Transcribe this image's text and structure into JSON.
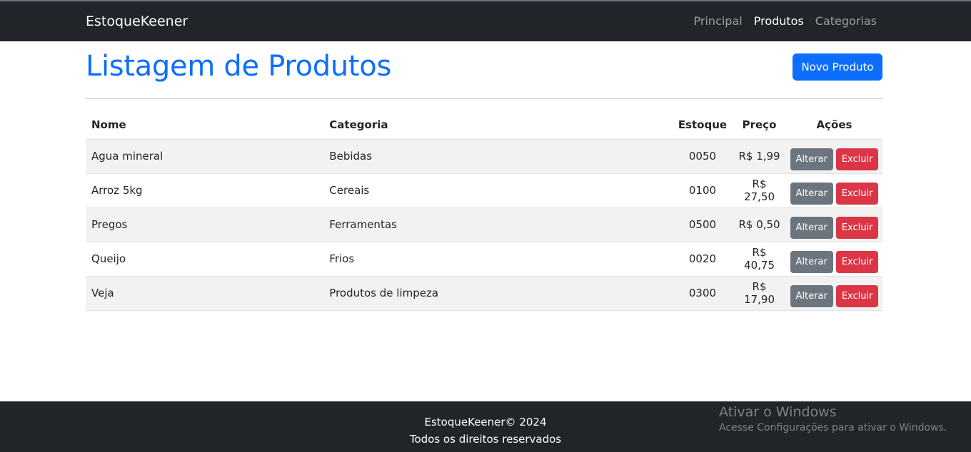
{
  "navbar": {
    "brand": "EstoqueKeener",
    "links": [
      {
        "label": "Principal",
        "active": false
      },
      {
        "label": "Produtos",
        "active": true
      },
      {
        "label": "Categorias",
        "active": false
      }
    ]
  },
  "page": {
    "title": "Listagem de Produtos",
    "new_button": "Novo Produto"
  },
  "table": {
    "headers": {
      "nome": "Nome",
      "categoria": "Categoria",
      "estoque": "Estoque",
      "preco": "Preço",
      "acoes": "Ações"
    },
    "rows": [
      {
        "nome": "Agua mineral",
        "categoria": "Bebidas",
        "estoque": "0050",
        "preco": "R$ 1,99",
        "alterar": "Alterar",
        "excluir": "Excluir"
      },
      {
        "nome": "Arroz 5kg",
        "categoria": "Cereais",
        "estoque": "0100",
        "preco": "R$ 27,50",
        "alterar": "Alterar",
        "excluir": "Excluir"
      },
      {
        "nome": "Pregos",
        "categoria": "Ferramentas",
        "estoque": "0500",
        "preco": "R$ 0,50",
        "alterar": "Alterar",
        "excluir": "Excluir"
      },
      {
        "nome": "Queijo",
        "categoria": "Frios",
        "estoque": "0020",
        "preco": "R$ 40,75",
        "alterar": "Alterar",
        "excluir": "Excluir"
      },
      {
        "nome": "Veja",
        "categoria": "Produtos de limpeza",
        "estoque": "0300",
        "preco": "R$ 17,90",
        "alterar": "Alterar",
        "excluir": "Excluir"
      }
    ]
  },
  "footer": {
    "line1": "EstoqueKeener© 2024",
    "line2": "Todos os direitos reservados"
  },
  "watermark": {
    "title": "Ativar o Windows",
    "subtitle": "Acesse Configurações para ativar o Windows."
  },
  "colors": {
    "primary": "#0d6efd",
    "secondary": "#6c757d",
    "danger": "#dc3545",
    "dark": "#212529"
  }
}
